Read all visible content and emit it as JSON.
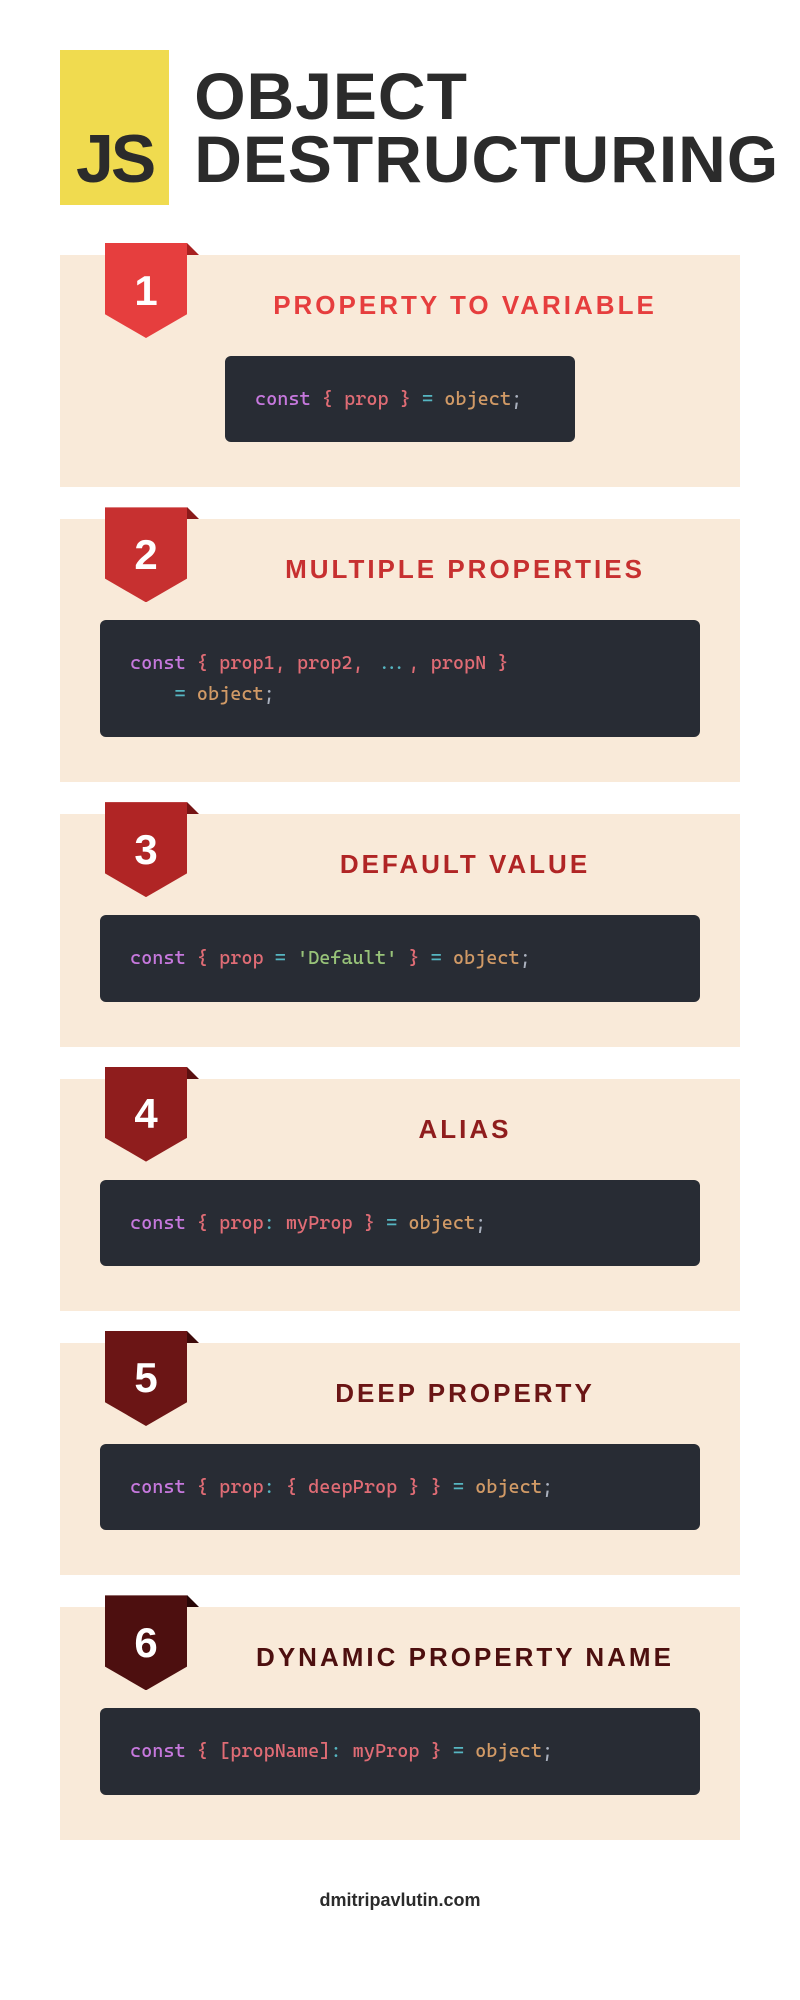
{
  "logo": {
    "text": "JS"
  },
  "title": "OBJECT\nDESTRUCTURING",
  "sections": [
    {
      "number": "1",
      "title": "PROPERTY TO VARIABLE",
      "code": {
        "keyword": "const",
        "content": " { prop } ",
        "operator": "=",
        "value": " object",
        "semi": ";"
      }
    },
    {
      "number": "2",
      "title": "MULTIPLE PROPERTIES",
      "code": {
        "keyword": "const",
        "line1_props": " { prop1, prop2, ",
        "line1_spread": "...",
        "line1_rest": ", propN }",
        "line2_indent": "    ",
        "operator": "=",
        "value": " object",
        "semi": ";"
      }
    },
    {
      "number": "3",
      "title": "DEFAULT VALUE",
      "code": {
        "keyword": "const",
        "open": " { prop ",
        "eq": "=",
        "default": " 'Default'",
        "close": " } ",
        "operator": "=",
        "value": " object",
        "semi": ";"
      }
    },
    {
      "number": "4",
      "title": "ALIAS",
      "code": {
        "keyword": "const",
        "open": " { prop",
        "colon": ":",
        "alias": " myProp } ",
        "operator": "=",
        "value": " object",
        "semi": ";"
      }
    },
    {
      "number": "5",
      "title": "DEEP PROPERTY",
      "code": {
        "keyword": "const",
        "open": " { prop",
        "colon": ":",
        "nested": " { deepProp } } ",
        "operator": "=",
        "value": " object",
        "semi": ";"
      }
    },
    {
      "number": "6",
      "title": "DYNAMIC PROPERTY NAME",
      "code": {
        "keyword": "const",
        "open": " { [propName]",
        "colon": ":",
        "alias": " myProp } ",
        "operator": "=",
        "value": " object",
        "semi": ";"
      }
    }
  ],
  "footer": "dmitripavlutin.com"
}
